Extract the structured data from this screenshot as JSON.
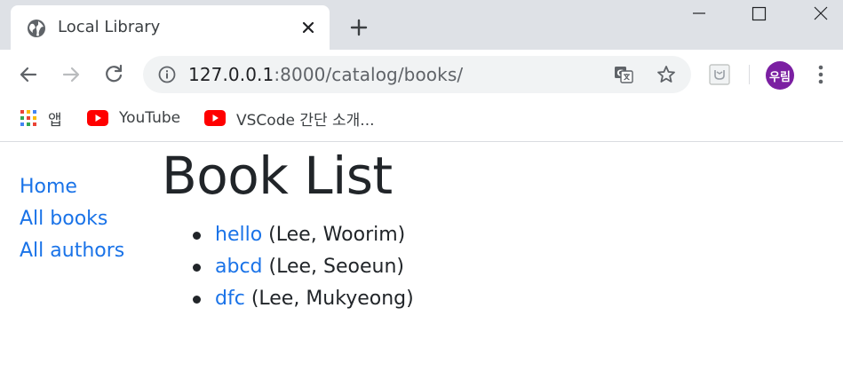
{
  "colors": {
    "tabstrip": "#dee1e6",
    "link": "#1a73e8",
    "text": "#212529",
    "avatar": "#7b1fa2"
  },
  "browser": {
    "tab": {
      "title": "Local Library",
      "favicon": "globe-icon"
    },
    "address": {
      "host": "127.0.0.1",
      "port_path": ":8000/catalog/books/"
    },
    "profile": {
      "label": "우림"
    },
    "bookmarks": [
      {
        "label": "앱",
        "icon": "apps-grid-icon"
      },
      {
        "label": "YouTube",
        "icon": "youtube-icon"
      },
      {
        "label": "VSCode 간단 소개...",
        "icon": "youtube-icon"
      }
    ]
  },
  "page": {
    "sidebar": [
      {
        "label": "Home"
      },
      {
        "label": "All books"
      },
      {
        "label": "All authors"
      }
    ],
    "title": "Book List",
    "books": [
      {
        "title": "hello",
        "author": "(Lee, Woorim)"
      },
      {
        "title": "abcd",
        "author": "(Lee, Seoeun)"
      },
      {
        "title": "dfc",
        "author": "(Lee, Mukyeong)"
      }
    ]
  }
}
